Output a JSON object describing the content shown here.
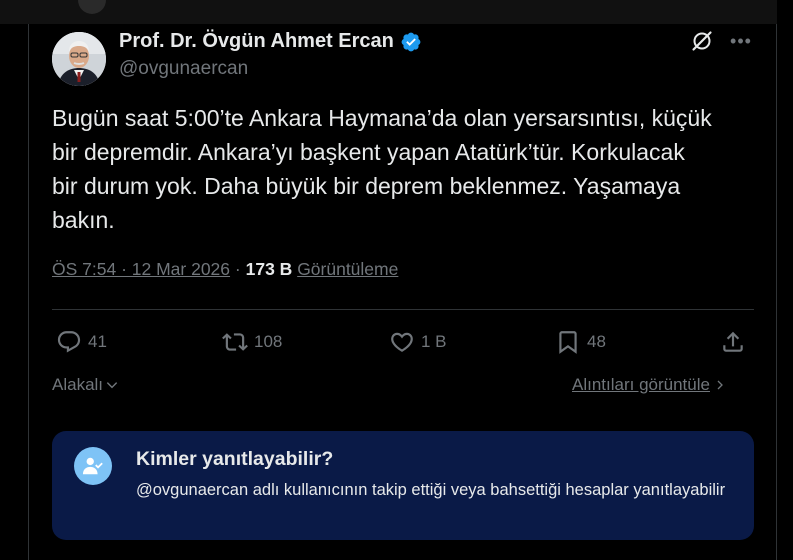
{
  "tweet": {
    "author_name": "Prof. Dr. Övgün Ahmet Ercan",
    "handle": "@ovgunaercan",
    "text": "Bugün saat 5:00’te Ankara Haymana’da olan yersarsıntısı, küçük\nbir depremdir. Ankara’yı başkent yapan Atatürk’tür. Korkulacak\nbir durum yok. Daha büyük bir deprem beklenmez. Yaşamaya\nbakın.",
    "timestamp": "ÖS 7:54 · 12 Mar 2026",
    "separator": "·",
    "views_count": "173 B",
    "views_label": "Görüntüleme"
  },
  "actions": {
    "replies": "41",
    "reposts": "108",
    "likes": "1 B",
    "bookmarks": "48"
  },
  "links": {
    "related": "Alakalı",
    "view_quotes": "Alıntıları görüntüle"
  },
  "reply_restriction": {
    "title": "Kimler yanıtlayabilir?",
    "description": "@ovgunaercan adlı kullanıcının takip ettiği veya bahsettiği hesaplar yanıtlayabilir"
  },
  "colors": {
    "background": "#000000",
    "text": "#e7e9ea",
    "muted": "#71767b",
    "verified": "#1d9bf0",
    "card": "#0a1a47",
    "card_icon": "#7ec3f6"
  },
  "icons": [
    "verified-badge-icon",
    "grok-icon",
    "more-icon",
    "reply-icon",
    "repost-icon",
    "like-icon",
    "bookmark-icon",
    "share-icon",
    "chevron-down-icon",
    "chevron-right-icon",
    "person-check-icon"
  ]
}
